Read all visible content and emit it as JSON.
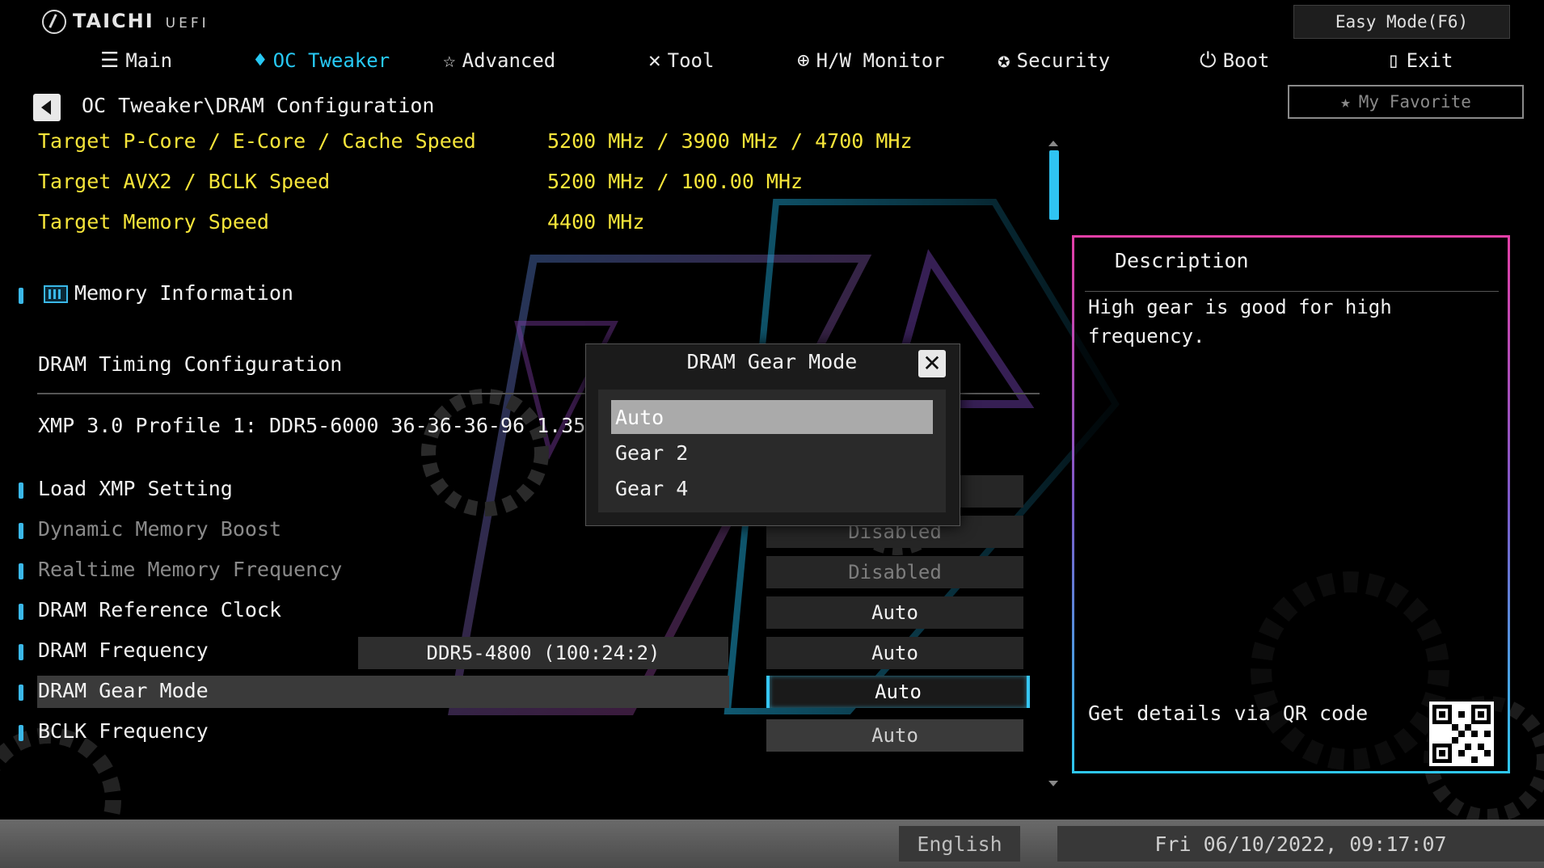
{
  "brand": {
    "name": "TAICHI",
    "suffix": "UEFI"
  },
  "easy_mode_label": "Easy Mode(F6)",
  "my_favorite_label": "My Favorite",
  "nav": [
    {
      "label": "Main",
      "icon": "list-icon"
    },
    {
      "label": "OC Tweaker",
      "icon": "rocket-icon",
      "active": true
    },
    {
      "label": "Advanced",
      "icon": "star-icon"
    },
    {
      "label": "Tool",
      "icon": "tool-icon"
    },
    {
      "label": "H/W Monitor",
      "icon": "monitor-icon"
    },
    {
      "label": "Security",
      "icon": "shield-icon"
    },
    {
      "label": "Boot",
      "icon": "power-icon"
    },
    {
      "label": "Exit",
      "icon": "exit-icon"
    }
  ],
  "breadcrumb": "OC Tweaker\\DRAM Configuration",
  "targets": [
    {
      "label": "Target P-Core / E-Core / Cache Speed",
      "value": "5200 MHz / 3900 MHz / 4700 MHz"
    },
    {
      "label": "Target AVX2 / BCLK Speed",
      "value": "5200 MHz / 100.00 MHz"
    },
    {
      "label": "Target Memory Speed",
      "value": "4400 MHz"
    }
  ],
  "memory_information": "Memory Information",
  "dram_timing_configuration": "DRAM Timing Configuration",
  "xmp_profile": "XMP 3.0 Profile 1: DDR5-6000 36-36-36-96 1.35V 1DPC",
  "settings": [
    {
      "label": "Load XMP Setting",
      "value": "",
      "dim": false
    },
    {
      "label": "Dynamic Memory Boost",
      "value": "Disabled",
      "dim": true
    },
    {
      "label": "Realtime Memory Frequency",
      "value": "Disabled",
      "dim": true
    },
    {
      "label": "DRAM Reference Clock",
      "value": "Auto",
      "dim": false
    },
    {
      "label": "DRAM Frequency",
      "value": "Auto",
      "extra": "DDR5-4800 (100:24:2)",
      "dim": false
    },
    {
      "label": "DRAM Gear Mode",
      "value": "Auto",
      "selected": true,
      "dim": false
    },
    {
      "label": "BCLK Frequency",
      "value": "Auto",
      "dim": false
    }
  ],
  "popup": {
    "title": "DRAM Gear Mode",
    "options": [
      "Auto",
      "Gear 2",
      "Gear 4"
    ],
    "highlighted": 0
  },
  "description": {
    "title": "Description",
    "text": "High gear is good for high frequency.",
    "qr_label": "Get details via QR code"
  },
  "footer": {
    "language": "English",
    "datetime": "Fri 06/10/2022, 09:17:07"
  },
  "colors": {
    "accent": "#27c9f5",
    "target_text": "#f6e53a",
    "panel_pink": "#e33fa7"
  }
}
